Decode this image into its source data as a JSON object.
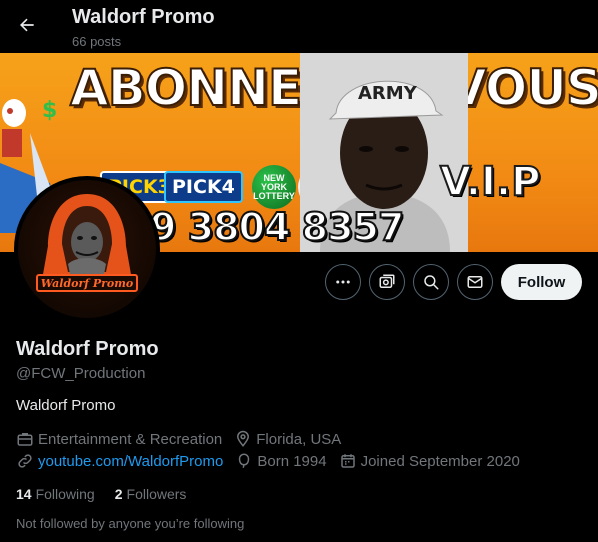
{
  "header": {
    "title": "Waldorf Promo",
    "post_count": "66 posts"
  },
  "banner": {
    "headline_left": "ABONNEZ",
    "headline_right": "VOUS",
    "phone": "9 3804 8357",
    "vip": "V.I.P",
    "pick3": "PICK3",
    "pick4": "PICK4",
    "ball1": "NEW YORK LOTTERY",
    "ball2": "lotter",
    "cap_text": "ARMY"
  },
  "avatar": {
    "logo_text": "Waldorf Promo"
  },
  "actions": {
    "follow_label": "Follow"
  },
  "profile": {
    "name": "Waldorf Promo",
    "handle": "@FCW_Production",
    "bio": "Waldorf Promo",
    "category": "Entertainment & Recreation",
    "location": "Florida, USA",
    "website": "youtube.com/WaldorfPromo",
    "born": "Born 1994",
    "joined": "Joined September 2020"
  },
  "stats": {
    "following_count": "14",
    "following_label": "Following",
    "followers_count": "2",
    "followers_label": "Followers"
  },
  "notice": "Not followed by anyone you’re following",
  "colors": {
    "background": "#000000",
    "text": "#e7e9ea",
    "muted": "#71767b",
    "link": "#1d9bf0",
    "button_bg": "#eff3f4",
    "banner_orange": "#f28b14"
  }
}
